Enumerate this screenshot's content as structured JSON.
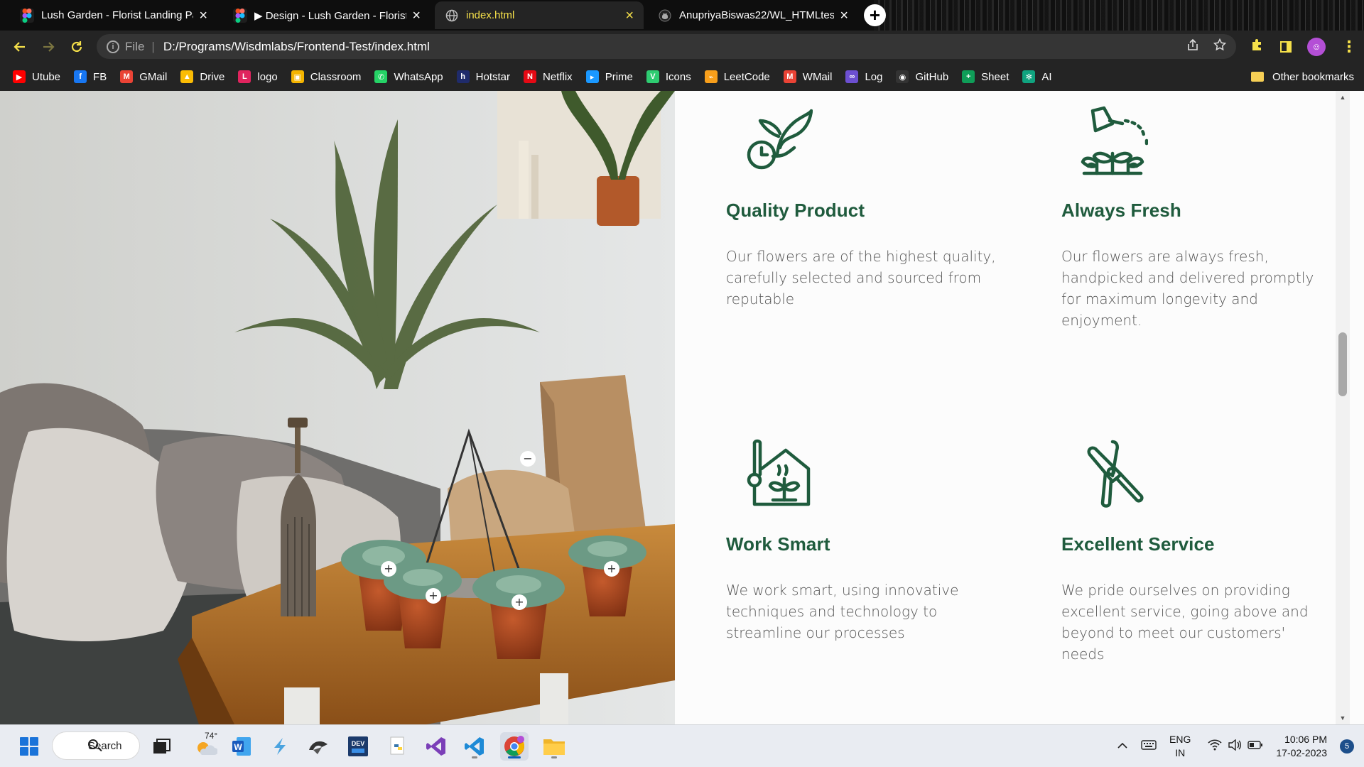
{
  "browser": {
    "tabs": [
      {
        "title": "Lush Garden - Florist Landing Pa",
        "icon": "figma-icon",
        "active": false
      },
      {
        "title": "▶ Design - Lush Garden - Florist",
        "icon": "figma-icon",
        "active": false
      },
      {
        "title": "index.html",
        "icon": "globe-icon",
        "active": true
      },
      {
        "title": "AnupriyaBiswas22/WL_HTMLtest",
        "icon": "github-icon",
        "active": false
      }
    ],
    "address": {
      "scheme": "File",
      "url": "D:/Programs/Wisdmlabs/Frontend-Test/index.html"
    },
    "bookmarks": [
      {
        "label": "Utube",
        "color": "#ff0000",
        "glyph": "▶"
      },
      {
        "label": "FB",
        "color": "#1877f2",
        "glyph": "f"
      },
      {
        "label": "GMail",
        "color": "#ea4335",
        "glyph": "M"
      },
      {
        "label": "Drive",
        "color": "#fbbc04",
        "glyph": "▲"
      },
      {
        "label": "logo",
        "color": "#e0245e",
        "glyph": "L"
      },
      {
        "label": "Classroom",
        "color": "#f4b400",
        "glyph": "▣"
      },
      {
        "label": "WhatsApp",
        "color": "#25d366",
        "glyph": "✆"
      },
      {
        "label": "Hotstar",
        "color": "#1f2b6b",
        "glyph": "h"
      },
      {
        "label": "Netflix",
        "color": "#e50914",
        "glyph": "N"
      },
      {
        "label": "Prime",
        "color": "#1a98ff",
        "glyph": "▸"
      },
      {
        "label": "Icons",
        "color": "#2ecc71",
        "glyph": "V"
      },
      {
        "label": "LeetCode",
        "color": "#f89f1b",
        "glyph": "⌁"
      },
      {
        "label": "WMail",
        "color": "#ea4335",
        "glyph": "M"
      },
      {
        "label": "Log",
        "color": "#6c4fd1",
        "glyph": "∞"
      },
      {
        "label": "GitHub",
        "color": "#333333",
        "glyph": "◉"
      },
      {
        "label": "Sheet",
        "color": "#0f9d58",
        "glyph": "+"
      },
      {
        "label": "AI",
        "color": "#10a37f",
        "glyph": "✻"
      }
    ],
    "other_bookmarks": "Other bookmarks"
  },
  "features": [
    {
      "title": "Quality Product",
      "text": "Our flowers are of the highest quality, carefully selected and sourced from reputable",
      "icon": "plant-clock-icon"
    },
    {
      "title": "Always Fresh",
      "text": "Our flowers are always fresh, handpicked and delivered promptly for maximum longevity and enjoyment.",
      "icon": "watering-can-icon"
    },
    {
      "title": "Work Smart",
      "text": "We work smart, using innovative techniques and technology to streamline our processes",
      "icon": "greenhouse-icon"
    },
    {
      "title": "Excellent Service",
      "text": "We pride ourselves on providing excellent service, going above and beyond to meet our customers' needs",
      "icon": "pruning-shears-icon"
    }
  ],
  "colors": {
    "accent_green": "#1f5b3d",
    "body_text": "#555555",
    "chrome_accent": "#f5e04a"
  },
  "taskbar": {
    "search_label": "Search",
    "weather_temp": "74°",
    "apps": [
      "file-explorer-icon",
      "word-icon",
      "thunder-icon",
      "edge-dev-icon",
      "devtoys-icon",
      "python-icon",
      "visual-studio-icon",
      "vscode-icon",
      "chrome-icon",
      "folder-icon"
    ],
    "lang_primary": "ENG",
    "lang_secondary": "IN",
    "time": "10:06 PM",
    "date": "17-02-2023",
    "notifications": "5"
  }
}
